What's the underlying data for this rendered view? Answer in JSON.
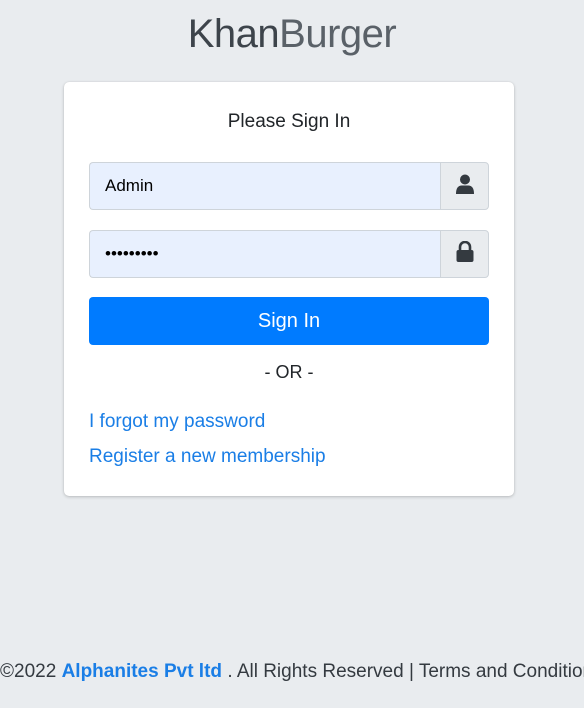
{
  "brand": {
    "bold": "Khan",
    "light": "Burger"
  },
  "login": {
    "title": "Please Sign In",
    "username_value": "Admin",
    "password_value": "Kh@n12345",
    "signin_label": "Sign In",
    "or_text": "- OR -",
    "forgot_link": "I forgot my password",
    "register_link": "Register a new membership"
  },
  "icons": {
    "username": "user-icon",
    "password": "lock-icon"
  },
  "footer": {
    "copyright": "©2022",
    "company": "Alphanites Pvt ltd",
    "rights": ". All Rights Reserved |",
    "terms": "Terms and Condition"
  },
  "colors": {
    "background": "#e9ecef",
    "primary": "#007bff",
    "link": "#1a7ee6",
    "autofill": "#e8f0fe"
  }
}
